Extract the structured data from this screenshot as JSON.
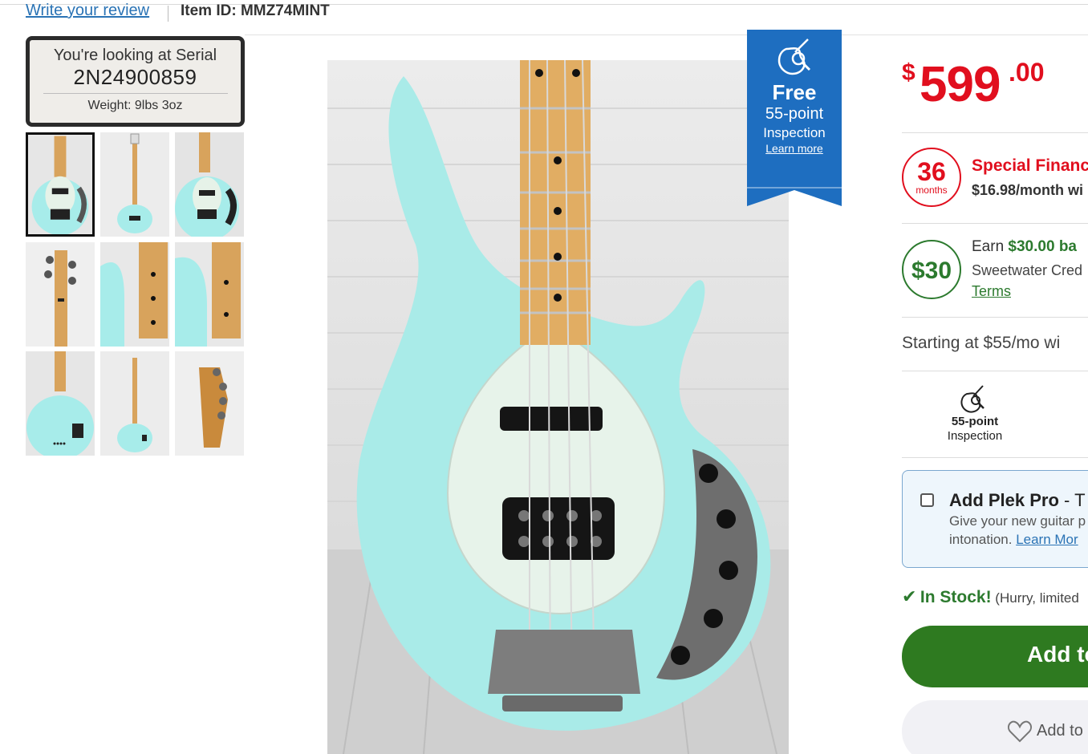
{
  "header": {
    "write_review": "Write your review",
    "item_id": "Item ID: MMZ74MINT"
  },
  "serial": {
    "line1": "You're looking at Serial",
    "number": "2N24900859",
    "weight": "Weight: 9lbs 3oz"
  },
  "gallery": {
    "thumbnails": [
      "front body",
      "full front",
      "angled body",
      "headstock front",
      "neck close-up",
      "body edge",
      "back body",
      "full back",
      "headstock back"
    ],
    "selected_index": 0
  },
  "ribbon": {
    "title": "Free",
    "line2": "55-point",
    "line3": "Inspection",
    "link": "Learn more"
  },
  "price": {
    "symbol": "$",
    "whole": "599",
    "cents": ".00"
  },
  "financing": {
    "months": "36",
    "months_label": "months",
    "title": "Special Financin",
    "sub": "$16.98/month wi"
  },
  "cashback": {
    "badge": "$30",
    "earn_prefix": "Earn ",
    "earn_amount": "$30.00 ba",
    "line2": "Sweetwater Cred",
    "terms": "Terms"
  },
  "starting": "Starting at $55/mo wi",
  "inspection": {
    "icon": "guitar-magnifier-icon",
    "bold": "55-point",
    "label": "Inspection"
  },
  "plek": {
    "title": "Add Plek Pro",
    "title_rest": " - T",
    "desc1": "Give your new guitar p",
    "desc2_prefix": "intonation. ",
    "desc2_link": "Learn Mor",
    "checked": false
  },
  "stock": {
    "check": "✔",
    "status": "In Stock!",
    "hint": " (Hurry, limited"
  },
  "buttons": {
    "add_to_cart": "Add to",
    "wishlist": "Add to"
  },
  "colors": {
    "price_red": "#e10f1e",
    "green": "#2c7a2e",
    "link_blue": "#2a73b5",
    "ribbon_blue": "#1e6ec0"
  }
}
